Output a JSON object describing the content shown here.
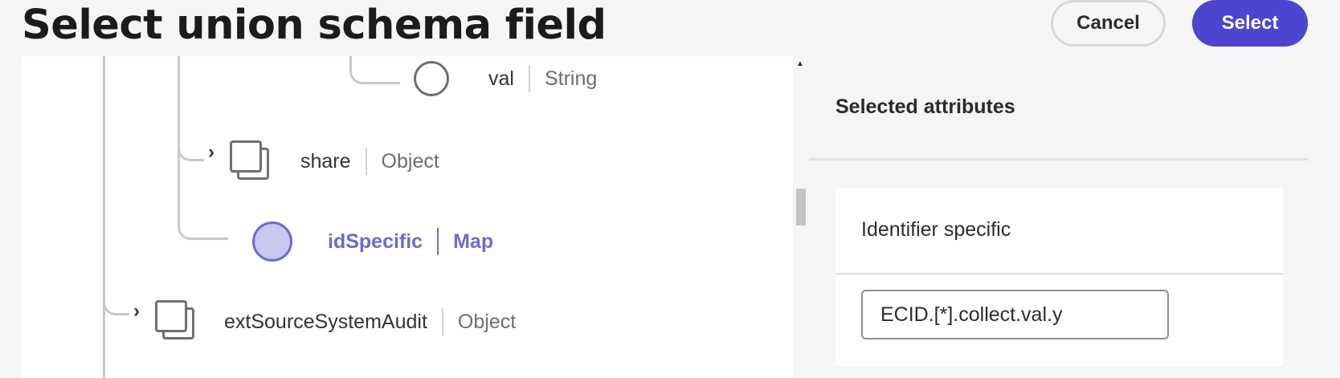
{
  "header": {
    "title": "Select union schema field",
    "cancel_label": "Cancel",
    "select_label": "Select"
  },
  "tree": {
    "nodes": [
      {
        "name": "val",
        "type": "String",
        "icon": "field-circle-icon",
        "selected": false
      },
      {
        "name": "share",
        "type": "Object",
        "icon": "object-icon",
        "expandable": true,
        "selected": false
      },
      {
        "name": "idSpecific",
        "type": "Map",
        "icon": "field-circle-icon",
        "selected": true
      },
      {
        "name": "extSourceSystemAudit",
        "type": "Object",
        "icon": "object-icon",
        "expandable": true,
        "selected": false
      }
    ]
  },
  "selected_panel": {
    "title": "Selected attributes",
    "card": {
      "title": "Identifier specific",
      "value": "ECID.[*].collect.val.y"
    }
  },
  "colors": {
    "accent": "#4c45cf",
    "selected_node": "#6e6acf"
  }
}
